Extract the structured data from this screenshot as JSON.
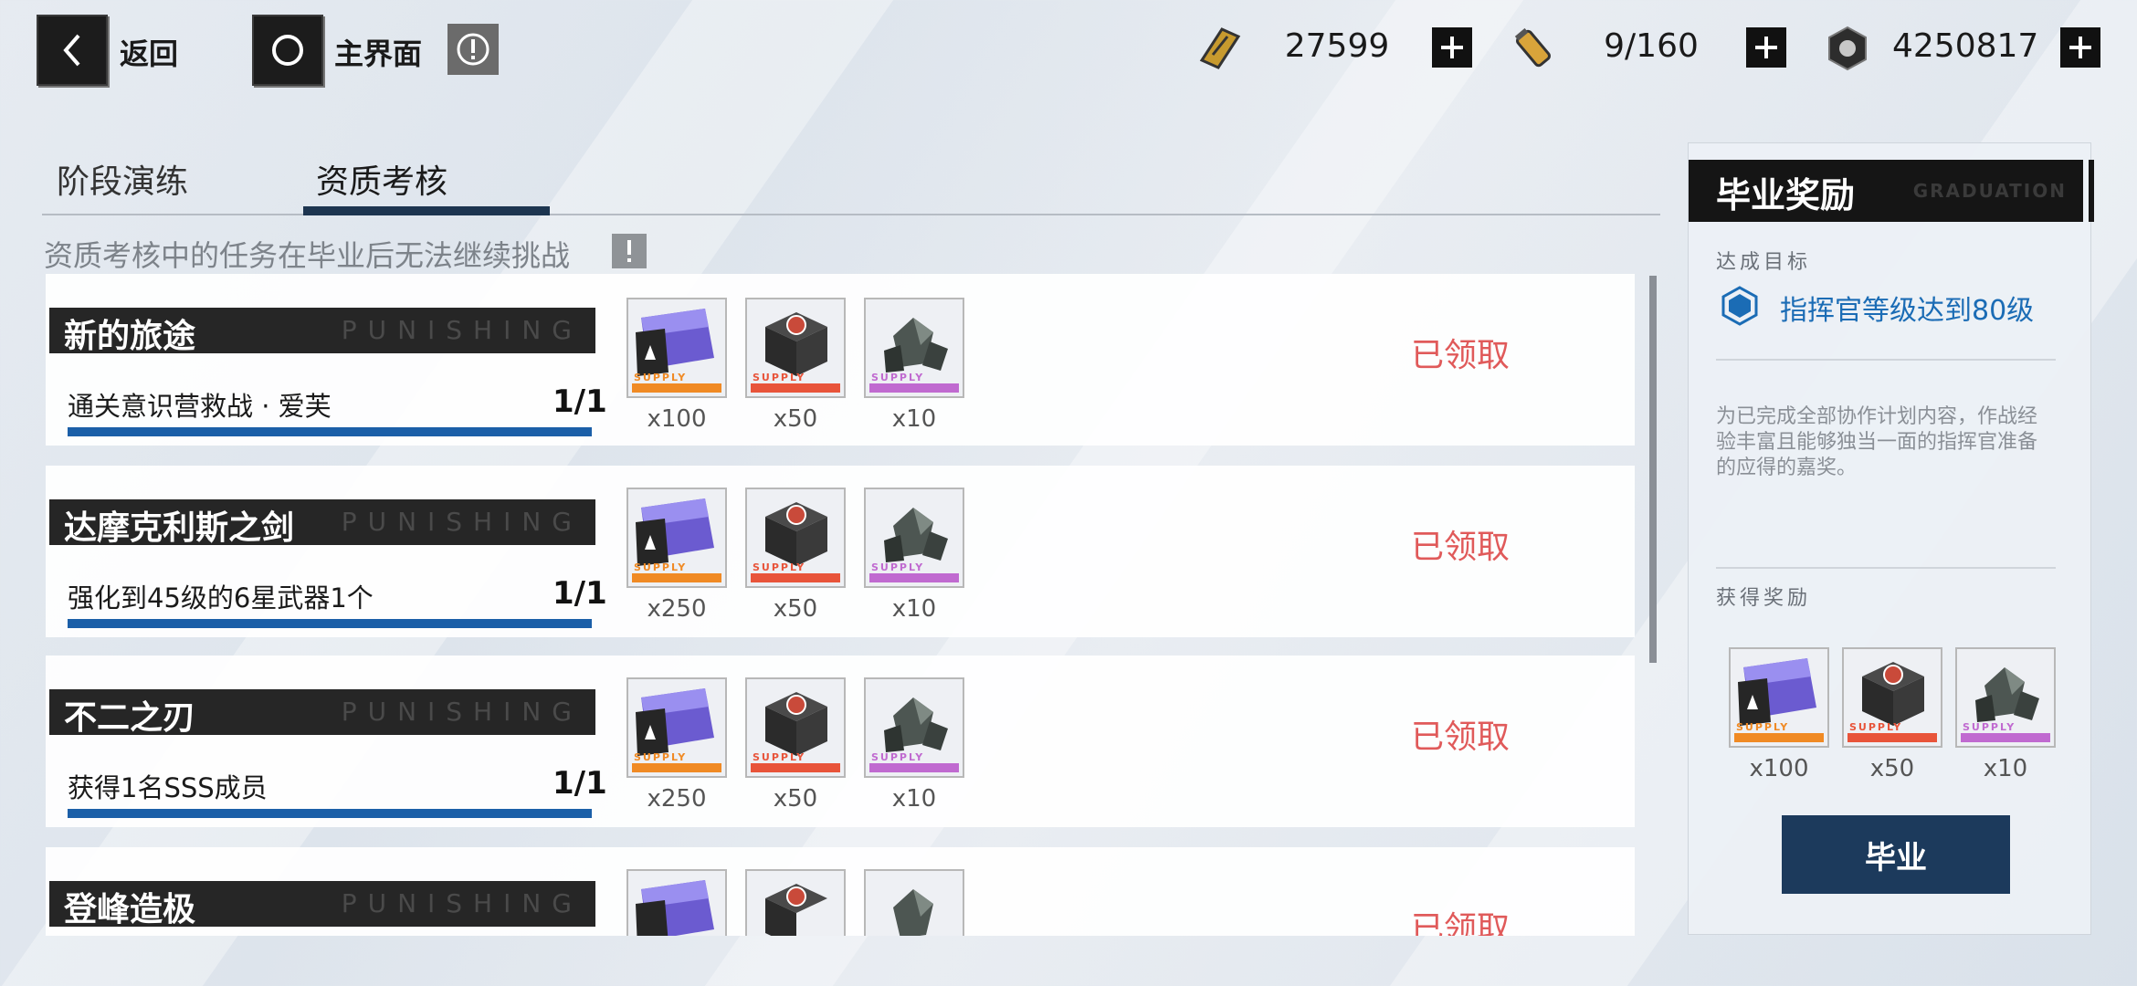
{
  "topbar": {
    "back_label": "返回",
    "home_label": "主界面",
    "resources": [
      {
        "icon": "gold-bar-icon",
        "value": "27599"
      },
      {
        "icon": "serum-icon",
        "value": "9/160"
      },
      {
        "icon": "nut-icon",
        "value": "4250817"
      }
    ]
  },
  "tabs": [
    {
      "label": "阶段演练",
      "active": false
    },
    {
      "label": "资质考核",
      "active": true
    }
  ],
  "notice": "资质考核中的任务在毕业后无法继续挑战",
  "watermark": "PUNISHING",
  "tasks": [
    {
      "title": "新的旅途",
      "desc": "通关意识营救战 · 爱芙",
      "count": "1/1",
      "status": "已领取",
      "rewards": [
        {
          "name": "supply-card",
          "qty": "x100"
        },
        {
          "name": "supply-box",
          "qty": "x50"
        },
        {
          "name": "supply-crystal",
          "qty": "x10"
        }
      ]
    },
    {
      "title": "达摩克利斯之剑",
      "desc": "强化到45级的6星武器1个",
      "count": "1/1",
      "status": "已领取",
      "rewards": [
        {
          "name": "supply-card",
          "qty": "x250"
        },
        {
          "name": "supply-box",
          "qty": "x50"
        },
        {
          "name": "supply-crystal",
          "qty": "x10"
        }
      ]
    },
    {
      "title": "不二之刃",
      "desc": "获得1名SSS成员",
      "count": "1/1",
      "status": "已领取",
      "rewards": [
        {
          "name": "supply-card",
          "qty": "x250"
        },
        {
          "name": "supply-box",
          "qty": "x50"
        },
        {
          "name": "supply-crystal",
          "qty": "x10"
        }
      ]
    },
    {
      "title": "登峰造极",
      "status": "已领取"
    }
  ],
  "item_label": "SUPPLY",
  "panel": {
    "title": "毕业奖励",
    "watermark": "GRADUATION",
    "goal_label": "达成目标",
    "goal_text": "指挥官等级达到80级",
    "description": "为已完成全部协作计划内容，作战经验丰富且能够独当一面的指挥官准备的应得的嘉奖。",
    "reward_label": "获得奖励",
    "rewards": [
      {
        "name": "supply-card",
        "qty": "x100"
      },
      {
        "name": "supply-box",
        "qty": "x50"
      },
      {
        "name": "supply-crystal",
        "qty": "x10"
      }
    ],
    "button_label": "毕业"
  },
  "colors": {
    "accent_blue": "#1b5fa8",
    "claimed_red": "#e05a5a",
    "card_orange": "#f08a24",
    "box_red": "#e8543a",
    "crystal_purple": "#c06ad0"
  }
}
